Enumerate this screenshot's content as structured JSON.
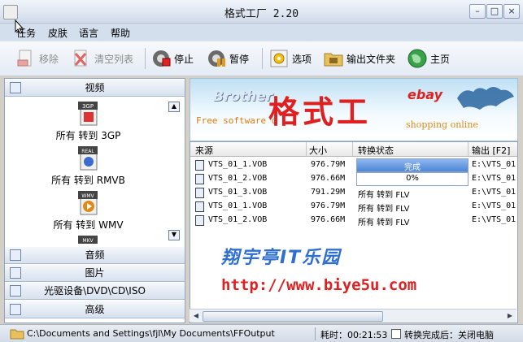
{
  "window": {
    "title": "格式工厂 2.20"
  },
  "menu": {
    "items": [
      "任务",
      "皮肤",
      "语言",
      "帮助"
    ]
  },
  "toolbar": {
    "remove": "移除",
    "clear_list": "清空列表",
    "stop": "停止",
    "pause": "暂停",
    "options": "选项",
    "output_folder": "输出文件夹",
    "home": "主页"
  },
  "sidebar": {
    "video": "视频",
    "formats": [
      {
        "badge": "3GP",
        "label": "所有 转到 3GP"
      },
      {
        "badge": "REAL",
        "label": "所有 转到 RMVB"
      },
      {
        "badge": "WMV",
        "label": "所有 转到 WMV"
      },
      {
        "badge": "MKV",
        "label": ""
      }
    ],
    "audio": "音频",
    "image": "图片",
    "rom": "光驱设备\\DVD\\CD\\ISO",
    "advanced": "高级"
  },
  "banner": {
    "brother": "Brother",
    "free_software": "Free software d",
    "title_overlay": "格式工",
    "ebay": "ebay",
    "shopping": "shopping online"
  },
  "table": {
    "headers": [
      "来源",
      "大小",
      "转换状态",
      "输出 [F2]"
    ],
    "rows": [
      {
        "source": "VTS_01_1.VOB",
        "size": "976.79M",
        "status": "完成",
        "progress": 1.0,
        "output": "E:\\VTS_01"
      },
      {
        "source": "VTS_01_2.VOB",
        "size": "976.66M",
        "status": "0%",
        "progress": 0.0,
        "output": "E:\\VTS_01"
      },
      {
        "source": "VTS_01_3.VOB",
        "size": "791.29M",
        "status": "所有 转到 FLV",
        "progress": null,
        "output": "E:\\VTS_01"
      },
      {
        "source": "VTS_01_1.VOB",
        "size": "976.79M",
        "status": "所有 转到 FLV",
        "progress": null,
        "output": "E:\\VTS_01"
      },
      {
        "source": "VTS_01_2.VOB",
        "size": "976.66M",
        "status": "所有 转到 FLV",
        "progress": null,
        "output": "E:\\VTS_01"
      }
    ]
  },
  "watermark": {
    "line1": "翔宇亭IT乐园",
    "line2": "http://www.biye5u.com"
  },
  "status": {
    "path": "C:\\Documents and Settings\\fjl\\My Documents\\FFOutput",
    "time": "耗时：00:21:53",
    "after": "转换完成后：关闭电脑"
  },
  "colors": {
    "accent": "#4d86d8",
    "watermark_blue": "#2f6fd1",
    "watermark_red": "#e02020"
  }
}
